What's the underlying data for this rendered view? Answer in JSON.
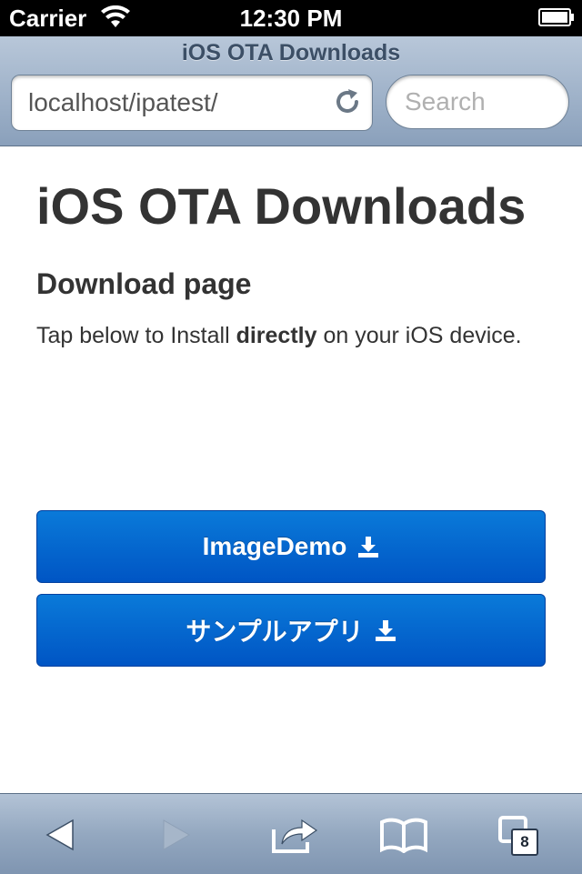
{
  "status_bar": {
    "carrier": "Carrier",
    "time": "12:30 PM"
  },
  "browser": {
    "page_title": "iOS OTA Downloads",
    "url": "localhost/ipatest/",
    "search_placeholder": "Search",
    "icons": [
      "reload-icon",
      "back-icon",
      "forward-icon",
      "share-icon",
      "bookmarks-icon",
      "tabs-icon"
    ],
    "tab_count": "8"
  },
  "page": {
    "heading": "iOS OTA Downloads",
    "subheading": "Download page",
    "description_before": "Tap below to Install ",
    "description_bold": "directly",
    "description_after": " on your iOS device.",
    "buttons": [
      {
        "label": "ImageDemo"
      },
      {
        "label": "サンプルアプリ"
      }
    ]
  },
  "colors": {
    "button_top": "#0a7ad9",
    "button_bottom": "#0055c4",
    "text": "#333333"
  }
}
